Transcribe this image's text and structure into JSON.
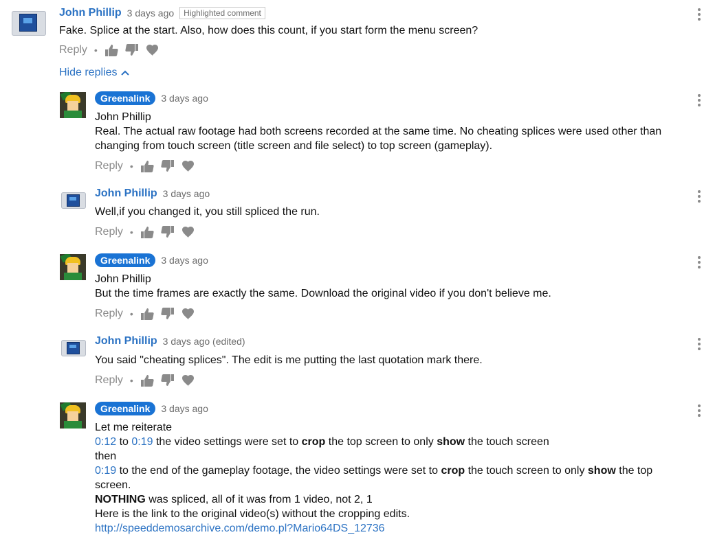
{
  "top_comment": {
    "author": "John Phillip",
    "time": "3 days ago",
    "badge": "Highlighted comment",
    "text": "Fake. Splice at the start. Also, how does this count, if you start form the menu screen?",
    "reply_label": "Reply"
  },
  "hide_replies_label": "Hide replies",
  "replies": [
    {
      "author": "Greenalink",
      "time": "3 days ago",
      "lines": [
        "John Phillip",
        "Real. The actual raw footage had both screens recorded at the same time. No cheating splices were used other than",
        "changing from touch screen (title screen and file select) to top screen (gameplay)."
      ],
      "reply_label": "Reply"
    },
    {
      "author": "John Phillip",
      "time": "3 days ago",
      "lines": [
        "Well,if you changed it, you still spliced the run."
      ],
      "reply_label": "Reply"
    },
    {
      "author": "Greenalink",
      "time": "3 days ago",
      "lines": [
        "John Phillip",
        "But the time frames are exactly the same. Download the original video if you don't believe me."
      ],
      "reply_label": "Reply"
    },
    {
      "author": "John Phillip",
      "time": "3 days ago (edited)",
      "lines": [
        "You said \"cheating splices\". The edit is me putting the last quotation mark there."
      ],
      "reply_label": "Reply"
    },
    {
      "author": "Greenalink",
      "time": "3 days ago",
      "line1": "Let me reiterate",
      "line2": {
        "t1": "0:12",
        "to": " to ",
        "t2": "0:19",
        "a": " the video settings were set to ",
        "b1": "crop",
        "b": " the top screen to only ",
        "b2": "show",
        "c": " the touch screen"
      },
      "line3": "then",
      "line4": {
        "t1": "0:19",
        "a": " to the end of the gameplay footage, the video settings were set to ",
        "b1": "crop",
        "b": " the touch screen to only ",
        "b2": "show",
        "c": " the top"
      },
      "line5": "screen.",
      "line6": {
        "b1": "NOTHING",
        "a": " was spliced, all of it was from 1 video, not 2, 1"
      },
      "line7": "Here is the link to the original video(s) without the cropping edits.",
      "line8": "http://speeddemosarchive.com/demo.pl?Mario64DS_12736"
    }
  ]
}
